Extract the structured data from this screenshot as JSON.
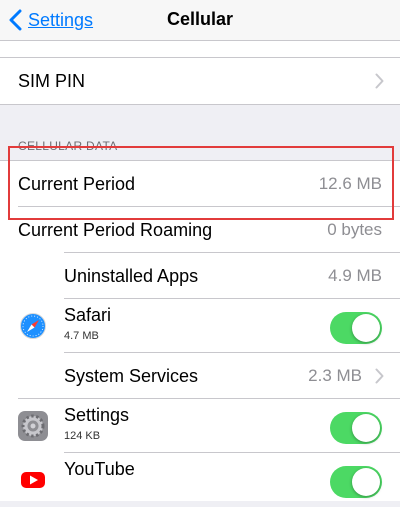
{
  "nav": {
    "back_label": "Settings",
    "title": "Cellular"
  },
  "sim_pin": {
    "label": "SIM PIN"
  },
  "cellular_data": {
    "header": "CELLULAR DATA",
    "current_period": {
      "label": "Current Period",
      "value": "12.6 MB"
    },
    "current_period_roaming": {
      "label": "Current Period Roaming",
      "value": "0 bytes"
    },
    "uninstalled_apps": {
      "label": "Uninstalled Apps",
      "value": "4.9 MB"
    },
    "apps": [
      {
        "name": "Safari",
        "usage": "4.7 MB",
        "icon": "safari-compass-icon",
        "enabled": true
      },
      {
        "name": "Settings",
        "usage": "124 KB",
        "icon": "settings-gear-icon",
        "enabled": true
      },
      {
        "name": "YouTube",
        "usage": "",
        "icon": "youtube-icon",
        "enabled": true
      }
    ],
    "system_services": {
      "label": "System Services",
      "value": "2.3 MB"
    }
  },
  "colors": {
    "accent": "#007aff",
    "toggle_on": "#4cd964",
    "highlight": "#e23b3b"
  }
}
